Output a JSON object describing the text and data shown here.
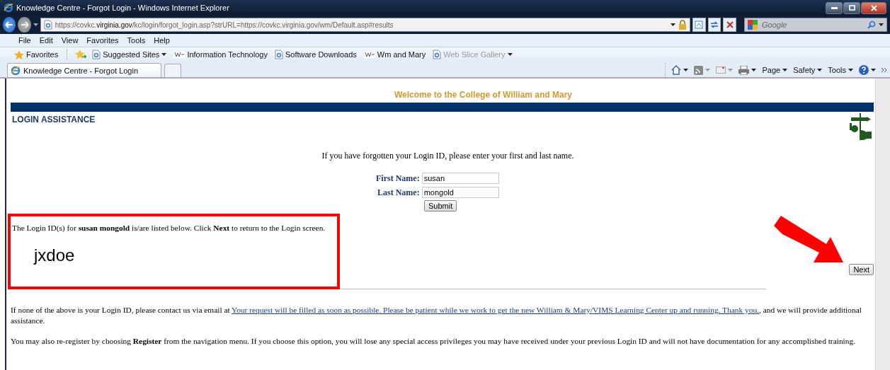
{
  "window": {
    "title": "Knowledge Centre - Forgot Login - Windows Internet Explorer"
  },
  "address_bar": {
    "url": "https://covkc.**virginia.gov**/kc/login/forgot_login.asp?strURL=https://covkc.virginia.gov/wm/Default.asp#results"
  },
  "search": {
    "placeholder": "Google"
  },
  "menu": [
    "File",
    "Edit",
    "View",
    "Favorites",
    "Tools",
    "Help"
  ],
  "favorites_bar": {
    "favorites_button": "Favorites",
    "items": [
      {
        "label": "Suggested Sites",
        "kind": "page",
        "dropdown": true,
        "disabled": false
      },
      {
        "label": "Information Technology",
        "kind": "site",
        "dropdown": false,
        "disabled": false
      },
      {
        "label": "Software Downloads",
        "kind": "page",
        "dropdown": false,
        "disabled": false
      },
      {
        "label": "Wm and Mary",
        "kind": "site",
        "dropdown": false,
        "disabled": false
      },
      {
        "label": "Web Slice Gallery",
        "kind": "page",
        "dropdown": true,
        "disabled": true
      }
    ]
  },
  "tabs": [
    {
      "label": "Knowledge Centre - Forgot Login",
      "selected": true
    }
  ],
  "command_bar": [
    "Page",
    "Safety",
    "Tools"
  ],
  "page": {
    "banner": "Welcome to the College of William and Mary",
    "heading": "LOGIN ASSISTANCE",
    "prompt": "If you have forgotten your Login ID, please enter your first and last name.",
    "fields": [
      {
        "label": "First Name:",
        "value": "susan"
      },
      {
        "label": "Last Name:",
        "value": "mongold"
      }
    ],
    "submit": "Submit",
    "result_message": "The Login ID(s) for **susan mongold** is/are listed below. Click **Next** to return to the Login screen.",
    "login_ids": [
      "jxdoe"
    ],
    "next": "Next",
    "contact": {
      "before": "If none of the above is your Login ID, please contact us via email at ",
      "link": "Your request will be filled as soon as possible. Please be patient while we work to get the new William & Mary/VIMS Learning Center up and running. Thank you.",
      "after": ", and we will provide additional assistance."
    },
    "register_note": "You may also re-register by choosing **Register** from the navigation menu. If you choose this option, you will lose any special access privileges you may have received under your previous Login ID and will not have documentation for any accomplished training."
  }
}
